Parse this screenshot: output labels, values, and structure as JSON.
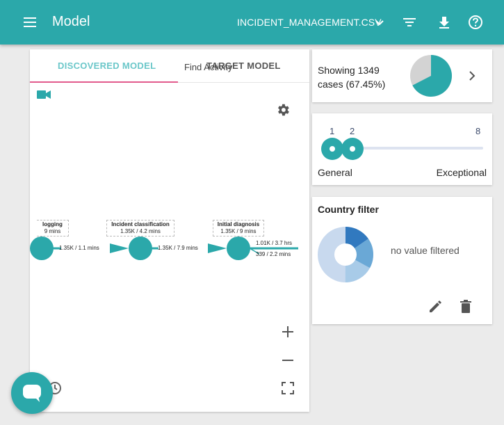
{
  "header": {
    "menu_icon": "menu-icon",
    "title": "Model",
    "file_name": "INCIDENT_MANAGEMENT.CSV",
    "icons": [
      "filter-icon",
      "download-icon",
      "help-icon"
    ]
  },
  "tabs": {
    "discovered": "DISCOVERED MODEL",
    "target": "TARGET MODEL",
    "find_activity_placeholder": "Find Activity"
  },
  "graph": {
    "nodes": [
      {
        "label": "logging",
        "stats": "9 mins"
      },
      {
        "label": "Incident classification",
        "stats": "1.35K / 4.2 mins"
      },
      {
        "label": "Initial diagnosis",
        "stats": "1.35K / 9 mins"
      }
    ],
    "edges": [
      "1.35K / 1.1 mins",
      "1.35K / 7.9 mins",
      "1.01K / 3.7 hrs",
      "339 / 2.2 mins"
    ]
  },
  "cases": {
    "text": "Showing 1349 cases (67.45%)",
    "fraction": 0.6745,
    "colors": {
      "shown": "#2ba8aa",
      "hidden": "#d3d3d3"
    }
  },
  "slider": {
    "ticks": [
      "1",
      "2",
      "8"
    ],
    "min_label": "General",
    "max_label": "Exceptional",
    "values": [
      1,
      2
    ],
    "range": [
      1,
      8
    ]
  },
  "country_filter": {
    "title": "Country filter",
    "empty_text": "no value filtered"
  },
  "colors": {
    "accent": "#2ba8aa",
    "tab_underline": "#e25a8c"
  }
}
